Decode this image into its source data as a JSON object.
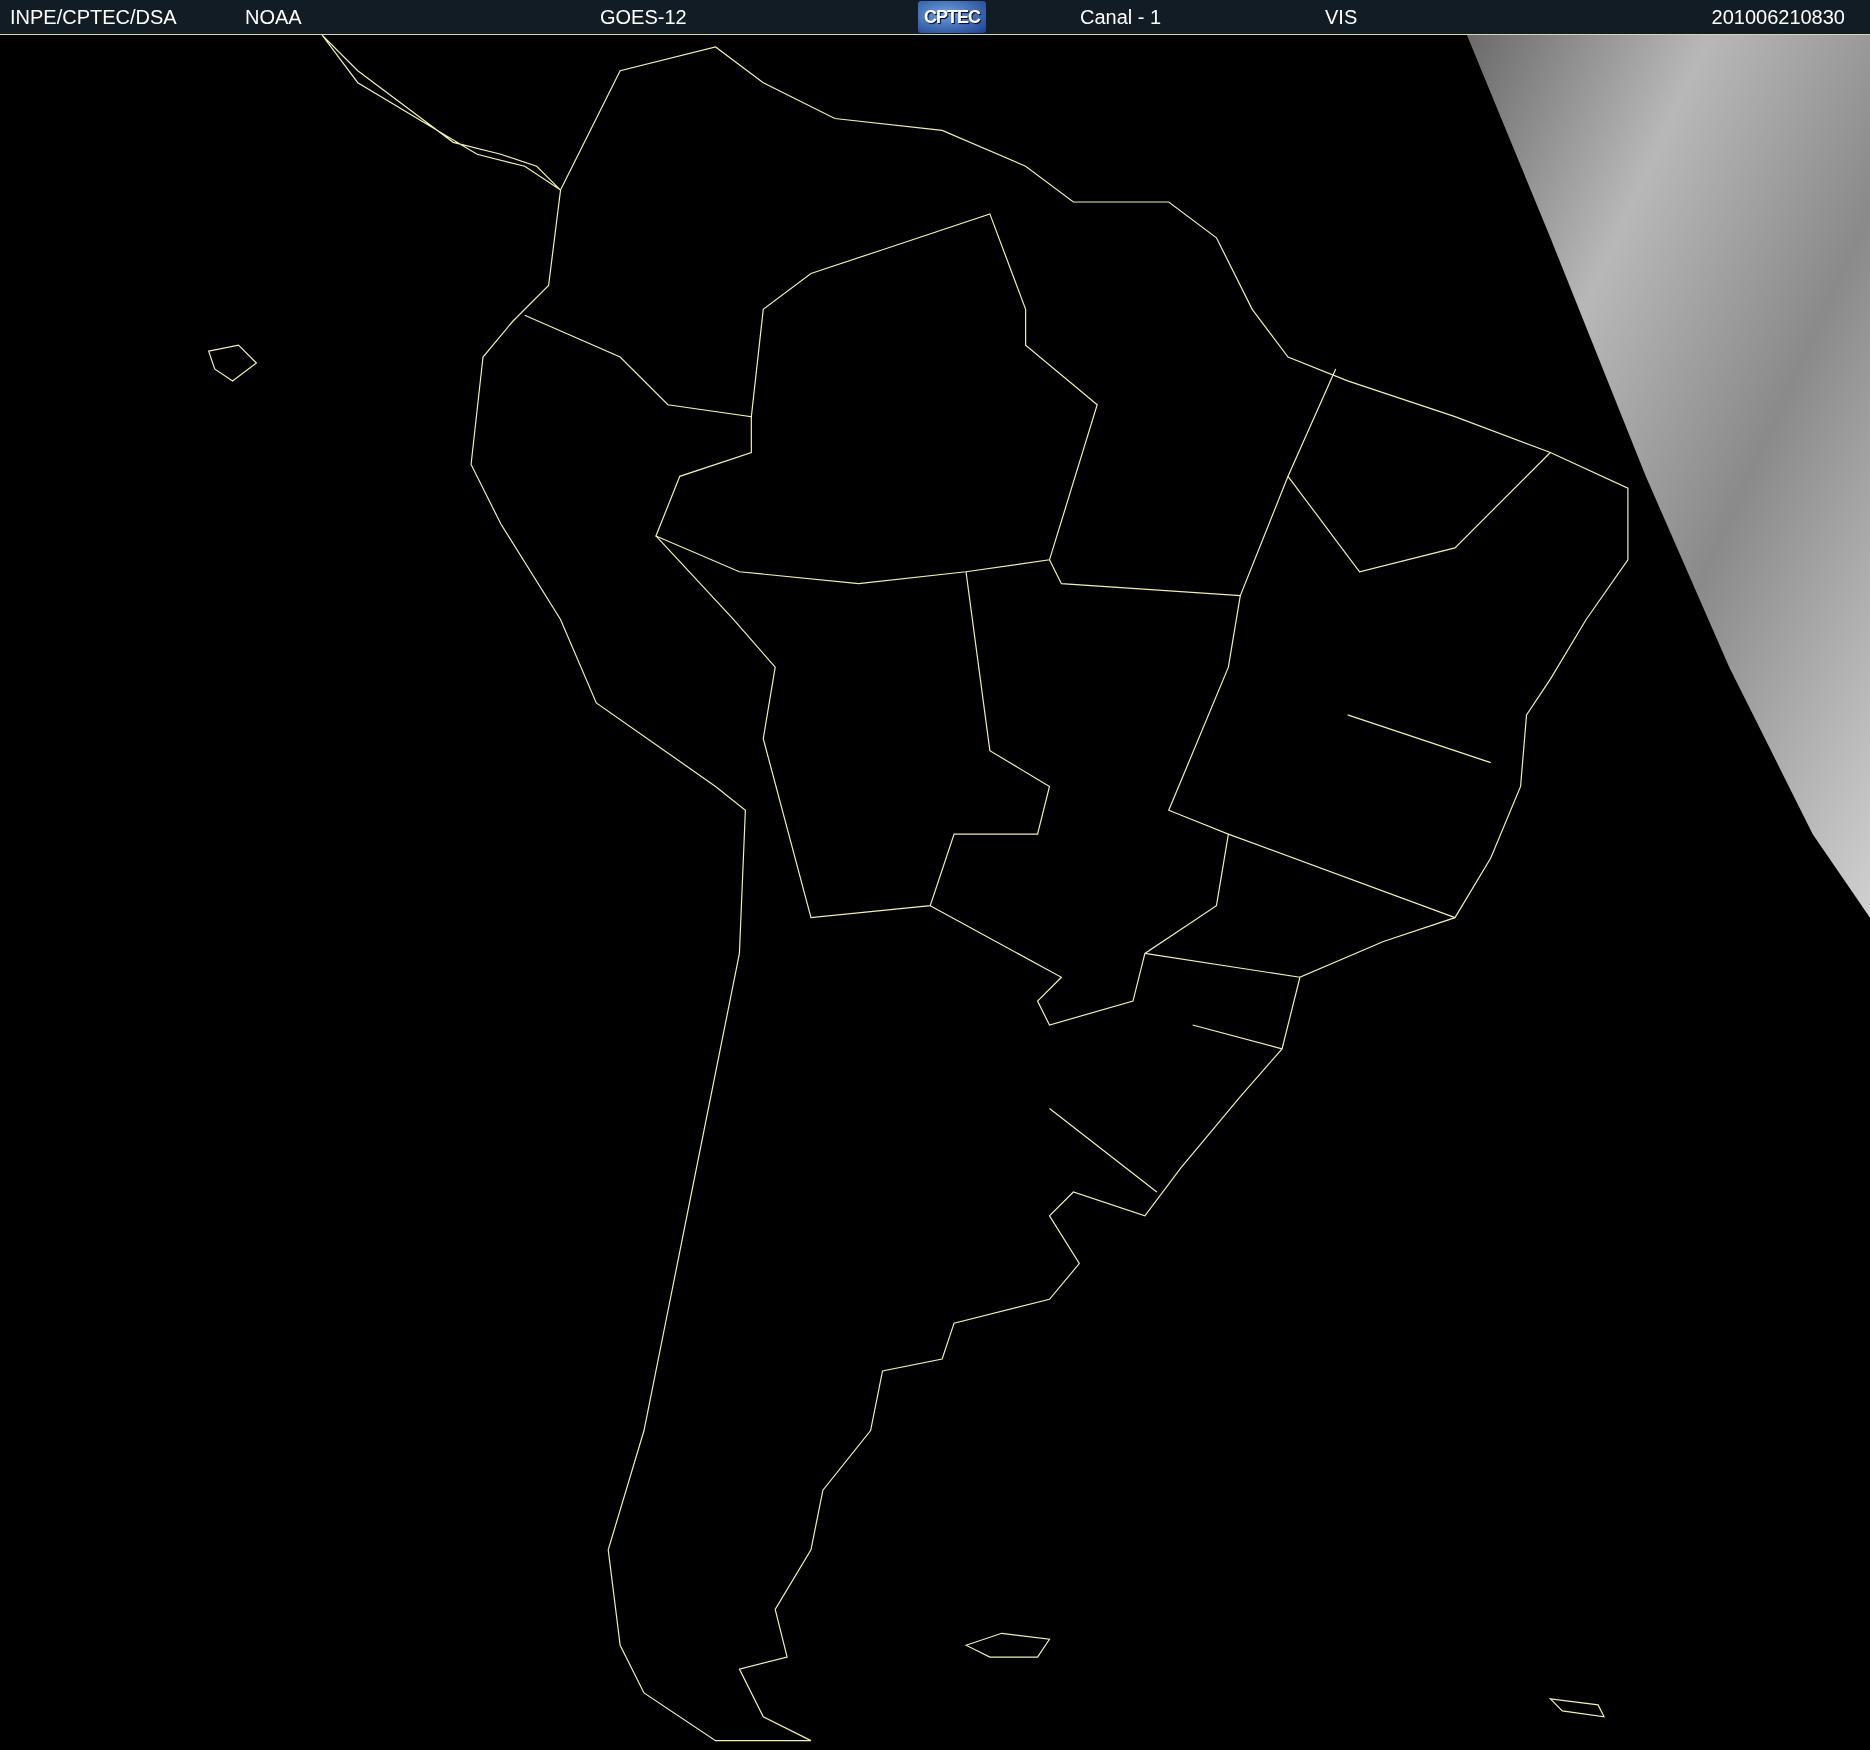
{
  "header": {
    "items": [
      {
        "kind": "text",
        "text": "INPE/CPTEC/DSA"
      },
      {
        "kind": "text",
        "text": "NOAA"
      },
      {
        "kind": "text",
        "text": "GOES-12"
      },
      {
        "kind": "logo",
        "text": "CPTEC"
      },
      {
        "kind": "text",
        "text": "Canal - 1"
      },
      {
        "kind": "text",
        "text": "VIS"
      },
      {
        "kind": "text",
        "text": "201006210830"
      }
    ]
  }
}
